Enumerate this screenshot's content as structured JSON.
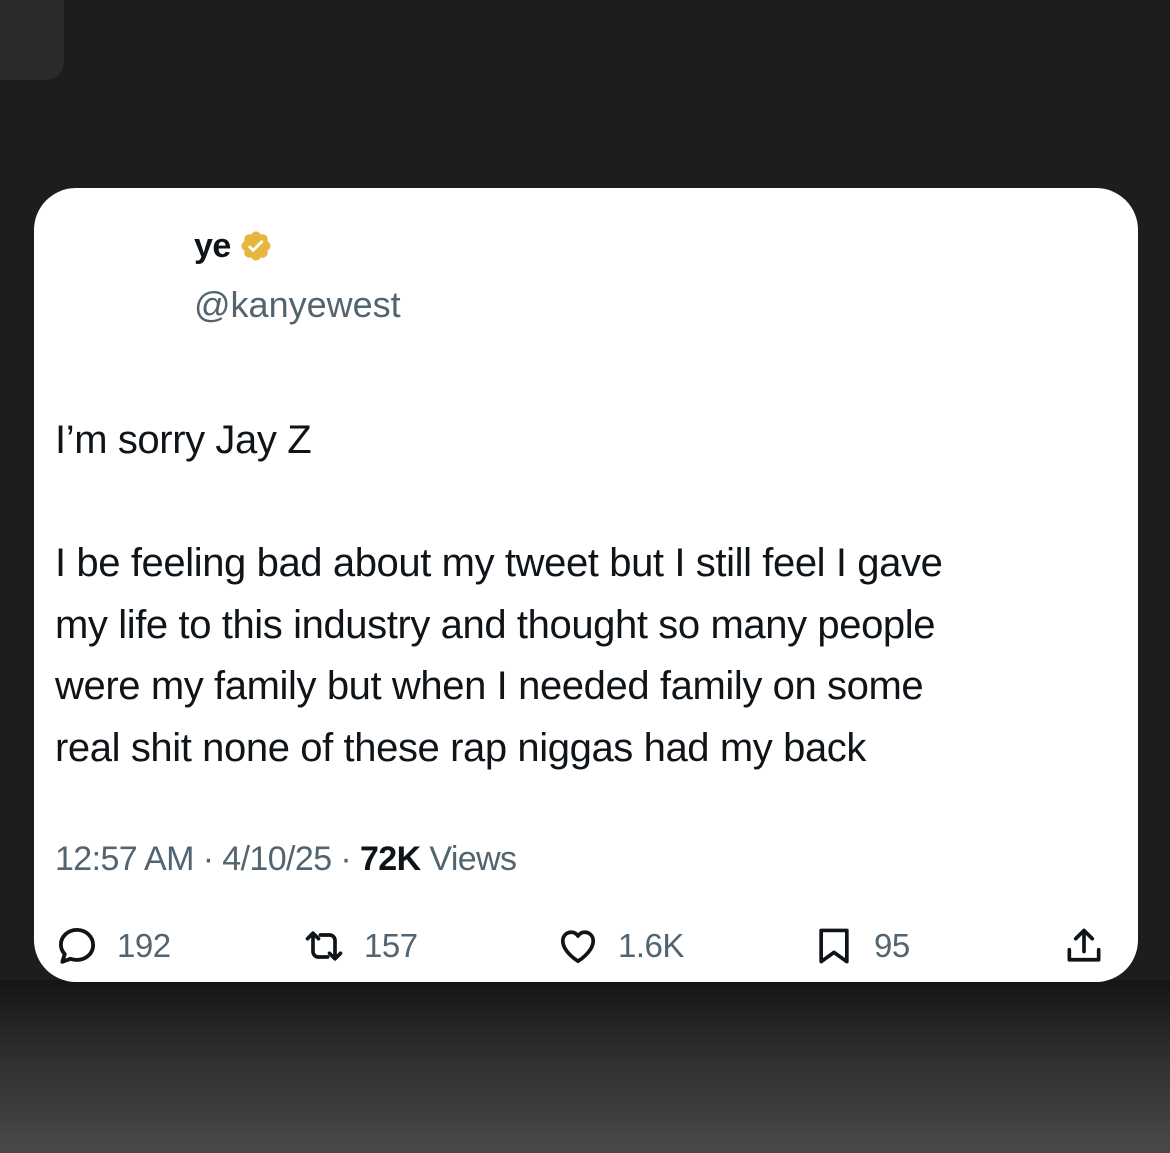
{
  "tweet": {
    "display_name": "ye",
    "handle": "@kanyewest",
    "verified_icon": "verified-badge-gold",
    "paragraphs": [
      "I’m sorry Jay Z",
      "I be feeling bad about my tweet but I still feel I gave\nmy life to this industry and thought so many people\nwere my family but when I needed family on some\nreal shit none of these rap niggas had my back"
    ],
    "time": "12:57 AM",
    "date": "4/10/25",
    "separator": " · ",
    "views_count": "72K",
    "views_label": " Views"
  },
  "actions": {
    "replies": {
      "icon": "reply-bubble-icon",
      "count": "192"
    },
    "reposts": {
      "icon": "repost-icon",
      "count": "157"
    },
    "likes": {
      "icon": "heart-icon",
      "count": "1.6K"
    },
    "bookmarks": {
      "icon": "bookmark-icon",
      "count": "95"
    },
    "share": {
      "icon": "share-upload-icon"
    }
  },
  "colors": {
    "background": "#1c1d1f",
    "card": "#ffffff",
    "text_primary": "#0f1419",
    "text_secondary": "#536471",
    "verified_gold": "#e8b53d"
  }
}
